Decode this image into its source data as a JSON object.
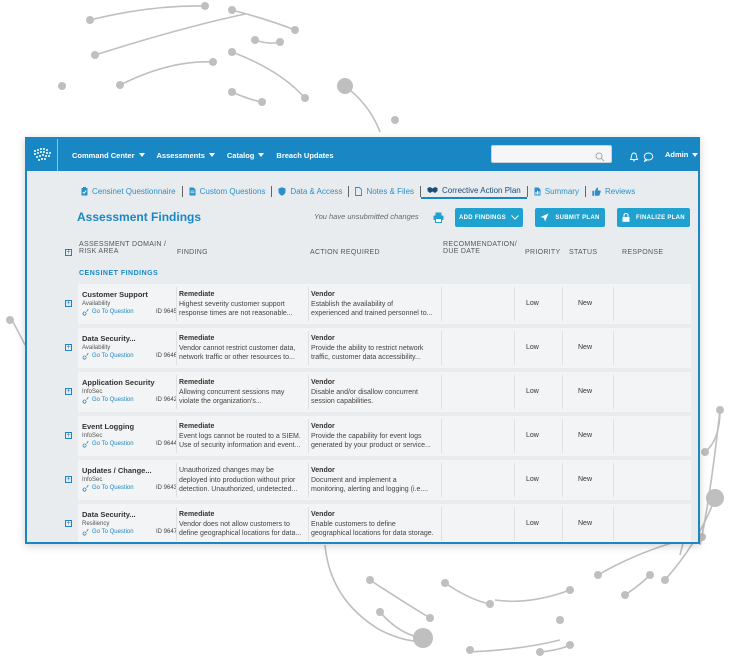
{
  "nav": {
    "items": [
      {
        "label": "Command Center"
      },
      {
        "label": "Assessments"
      },
      {
        "label": "Catalog"
      },
      {
        "label": "Breach Updates"
      }
    ],
    "search_placeholder": "",
    "admin_label": "Admin"
  },
  "tabs": [
    {
      "label": "Censinet Questionnaire",
      "icon": "clipboard-icon"
    },
    {
      "label": "Custom Questions",
      "icon": "document-icon"
    },
    {
      "label": "Data & Access",
      "icon": "shield-icon"
    },
    {
      "label": "Notes & Files",
      "icon": "file-icon"
    },
    {
      "label": "Corrective Action Plan",
      "icon": "handshake-icon",
      "active": true
    },
    {
      "label": "Summary",
      "icon": "summary-icon"
    },
    {
      "label": "Reviews",
      "icon": "thumbs-up-icon"
    }
  ],
  "page": {
    "title": "Assessment Findings",
    "unsubmitted": "You have unsubmitted changes",
    "add_findings": "ADD FINDINGS",
    "submit_plan": "SUBMIT PLAN",
    "finalize_plan": "FINALIZE PLAN"
  },
  "table": {
    "headers": {
      "domain_line1": "ASSESSMENT DOMAIN /",
      "domain_line2": "RISK AREA",
      "finding": "FINDING",
      "action": "ACTION REQUIRED",
      "rec_line1": "RECOMMENDATION/",
      "rec_line2": "DUE DATE",
      "priority": "PRIORITY",
      "status": "STATUS",
      "response": "RESPONSE"
    },
    "section": "CENSINET FINDINGS",
    "go_to_question": "Go To Question",
    "rows": [
      {
        "name": "Customer Support",
        "area": "Availability",
        "id": "ID 9645",
        "finding_head": "Remediate",
        "finding1": "Highest severity customer support",
        "finding2": "response times are not reasonable...",
        "action_head": "Vendor",
        "action1": "Establish the availability of",
        "action2": "experienced and trained personnel to...",
        "priority": "Low",
        "status": "New"
      },
      {
        "name": "Data Security...",
        "area": "Availability",
        "id": "ID 9646",
        "finding_head": "Remediate",
        "finding1": "Vendor cannot restrict customer data,",
        "finding2": "network traffic or other resources to...",
        "action_head": "Vendor",
        "action1": "Provide the ability to restrict network",
        "action2": "traffic, customer data accessibility...",
        "priority": "Low",
        "status": "New"
      },
      {
        "name": "Application Security",
        "area": "InfoSec",
        "id": "ID 9642",
        "finding_head": "Remediate",
        "finding1": "Allowing concurrent sessions may",
        "finding2": "violate the organization's...",
        "action_head": "Vendor",
        "action1": "Disable and/or disallow concurrent",
        "action2": "session capabilities.",
        "priority": "Low",
        "status": "New"
      },
      {
        "name": "Event Logging",
        "area": "InfoSec",
        "id": "ID 9644",
        "finding_head": "Remediate",
        "finding1": "Event logs cannot be routed to a SIEM.",
        "finding2": "Use of security information and event...",
        "action_head": "Vendor",
        "action1": "Provide the capability for event logs",
        "action2": "generated by your product or service...",
        "priority": "Low",
        "status": "New"
      },
      {
        "name": "Updates / Change...",
        "area": "InfoSec",
        "id": "ID 9643",
        "finding_head": "",
        "finding1": "Unauthorized changes may be",
        "finding2": "deployed into production without prior",
        "finding3": "detection. Unauthorized, undetected...",
        "action_head": "Vendor",
        "action1": "Document and implement a",
        "action2": "monitoring, alerting and logging (i.e....",
        "priority": "Low",
        "status": "New"
      },
      {
        "name": "Data Security...",
        "area": "Resiliency",
        "id": "ID 9647",
        "finding_head": "Remediate",
        "finding1": "Vendor does not allow customers to",
        "finding2": "define geographical locations for data...",
        "action_head": "Vendor",
        "action1": "Enable customers to define",
        "action2": "geographical locations for data storage.",
        "priority": "Low",
        "status": "New"
      }
    ]
  }
}
